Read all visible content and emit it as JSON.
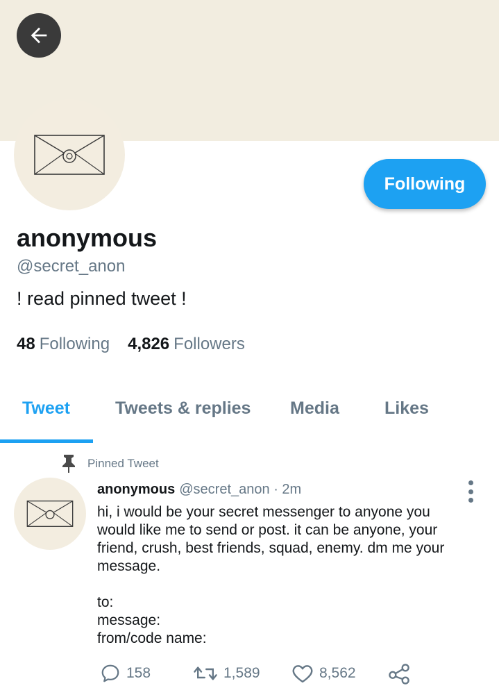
{
  "profile": {
    "display_name": "anonymous",
    "handle": "@secret_anon",
    "bio": "! read pinned tweet !",
    "follow_button_label": "Following",
    "following_count": "48",
    "following_label": "Following",
    "followers_count": "4,826",
    "followers_label": "Followers"
  },
  "tabs": [
    {
      "label": "Tweet",
      "active": true
    },
    {
      "label": "Tweets & replies",
      "active": false
    },
    {
      "label": "Media",
      "active": false
    },
    {
      "label": "Likes",
      "active": false
    }
  ],
  "pinned": {
    "label": "Pinned Tweet",
    "author_name": "anonymous",
    "author_meta": "@secret_anon · 2m",
    "lines": [
      "hi, i would be your secret messenger to anyone you would like me to send or post. it can be anyone, your friend, crush, best friends, squad, enemy. dm me your message.",
      "to:",
      "message:",
      "from/code name:"
    ],
    "replies": "158",
    "retweets": "1,589",
    "likes": "8,562"
  },
  "icons": {
    "back": "arrow-left-icon",
    "pin": "pin-icon",
    "more": "vertical-dots-icon",
    "reply": "speech-bubble-icon",
    "retweet": "retweet-icon",
    "like": "heart-icon",
    "share": "share-icon",
    "avatar": "envelope-icon"
  },
  "colors": {
    "accent": "#1da1f2",
    "banner": "#f2ede0",
    "secondary_text": "#657786"
  }
}
